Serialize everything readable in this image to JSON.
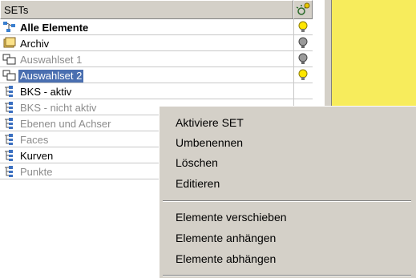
{
  "colors": {
    "selection": "#4a6fb0",
    "side_panel": "#f7ec5c",
    "bulb_on": "#ffe600",
    "bulb_off": "#9a9a9a"
  },
  "header": {
    "title": "SETs",
    "lamp_icon": "lamp-header-icon"
  },
  "rows": [
    {
      "label": "Alle Elemente",
      "icon": "all-elements-icon",
      "bulb": "on"
    },
    {
      "label": "Archiv",
      "icon": "archive-icon",
      "bulb": "off"
    },
    {
      "label": "Auswahlset 1",
      "icon": "selection-set-icon",
      "bulb": "off"
    },
    {
      "label": "Auswahlset 2",
      "icon": "selection-set-icon",
      "bulb": "on",
      "selected": true
    },
    {
      "label": "BKS - aktiv",
      "icon": "group-icon"
    },
    {
      "label": "BKS - nicht aktiv",
      "icon": "group-icon"
    },
    {
      "label": "Ebenen und Achser",
      "icon": "group-icon"
    },
    {
      "label": "Faces",
      "icon": "group-icon"
    },
    {
      "label": "Kurven",
      "icon": "group-icon"
    },
    {
      "label": "Punkte",
      "icon": "group-icon"
    }
  ],
  "context_menu": {
    "items": [
      "Aktiviere SET",
      "Umbenennen",
      "Löschen",
      "Editieren",
      "Elemente verschieben",
      "Elemente anhängen",
      "Elemente abhängen"
    ]
  }
}
